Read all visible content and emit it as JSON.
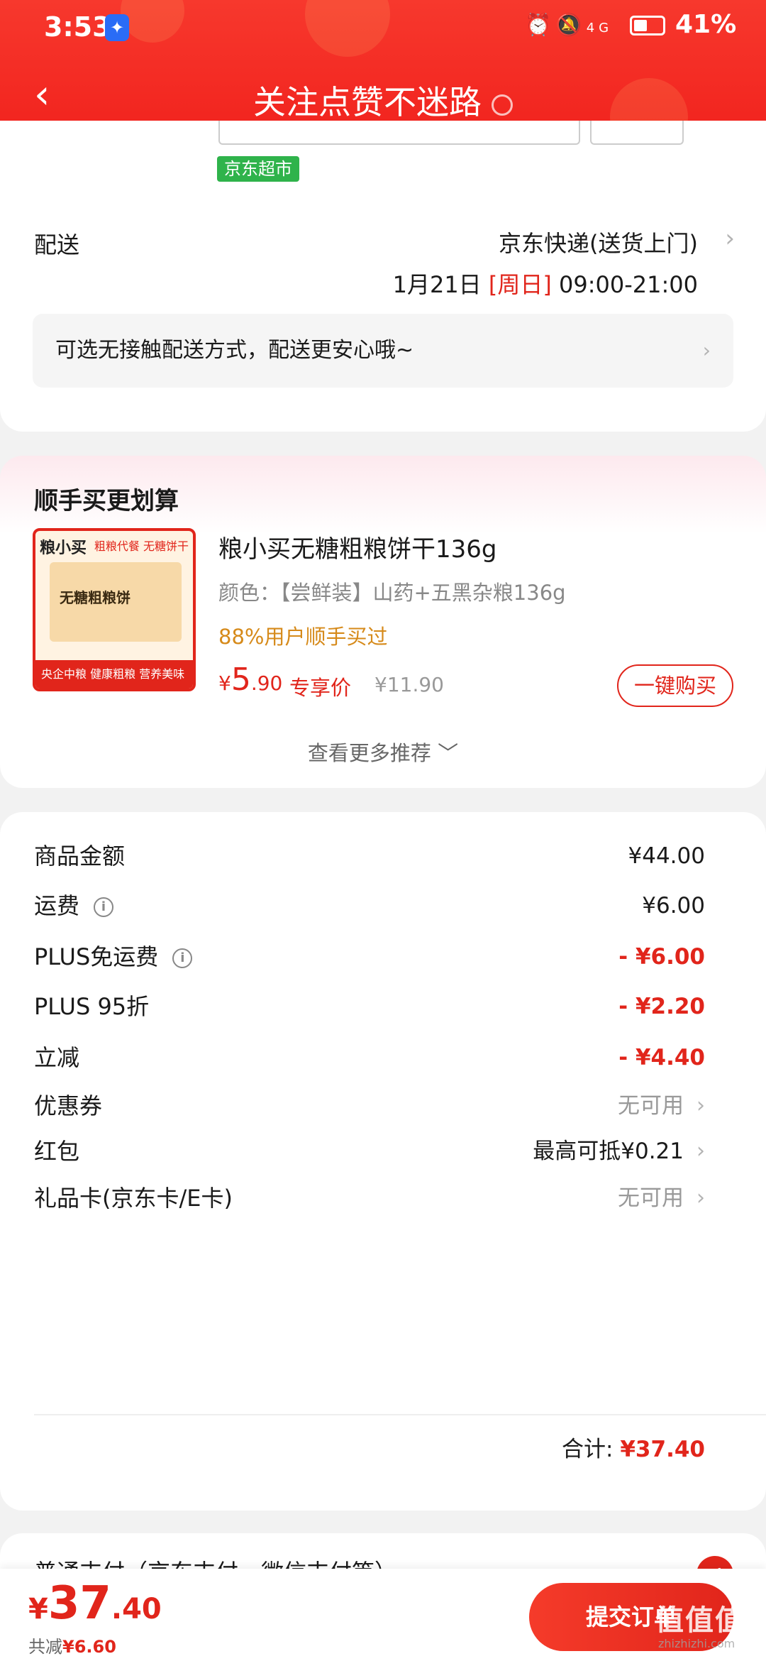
{
  "status_bar": {
    "time": "3:53",
    "network": "4G",
    "battery": "41%"
  },
  "nav": {
    "title": "关注点赞不迷路"
  },
  "store_tag": "京东超市",
  "delivery": {
    "label": "配送",
    "carrier": "京东快递(送货上门)",
    "date": "1月21日",
    "weekday": "[周日]",
    "time_window": "09:00-21:00",
    "contactless": "可选无接触配送方式，配送更安心哦~"
  },
  "recommend": {
    "title": "顺手买更划算",
    "product": {
      "thumb_brand": "粮小买",
      "thumb_tag": "粗粮代餐 无糖饼干",
      "thumb_box": "无糖粗粮饼",
      "thumb_bottom": "央企中粮 健康粗粮 营养美味",
      "name": "粮小买无糖粗粮饼干136g",
      "spec": "颜色：【尝鲜装】山药+五黑杂粮136g",
      "bought": "88%用户顺手买过",
      "price_yen": "¥",
      "price_int": "5",
      "price_dec": ".90",
      "exclusive": "专享价",
      "original": "¥11.90",
      "buy_label": "一键购买"
    },
    "more": "查看更多推荐 ﹀"
  },
  "summary": {
    "rows": [
      {
        "label": "商品金额",
        "value": "¥44.00"
      },
      {
        "label": "运费",
        "value": "¥6.00"
      },
      {
        "label": "PLUS免运费",
        "value": "- ¥6.00"
      },
      {
        "label": "PLUS 95折",
        "value": "- ¥2.20"
      },
      {
        "label": "立减",
        "value": "- ¥4.40"
      },
      {
        "label": "优惠券",
        "value": "无可用"
      },
      {
        "label": "红包",
        "value": "最高可抵¥0.21"
      },
      {
        "label": "礼品卡(京东卡/E卡)",
        "value": "无可用"
      }
    ],
    "total_label": "合计:",
    "total_value": "¥37.40"
  },
  "payment": {
    "label": "普通支付（京东支付、微信支付等）"
  },
  "bottom": {
    "yen": "¥",
    "int": "37",
    "dec": ".40",
    "saved_label": "共减",
    "saved_value": "¥6.60",
    "submit": "提交订单"
  },
  "watermark": {
    "text": "值值值",
    "site": "zhizhizhi.com"
  },
  "colors": {
    "brand_red": "#e1251b",
    "header_red": "#f1221d",
    "jd_green": "#2fb34b"
  }
}
